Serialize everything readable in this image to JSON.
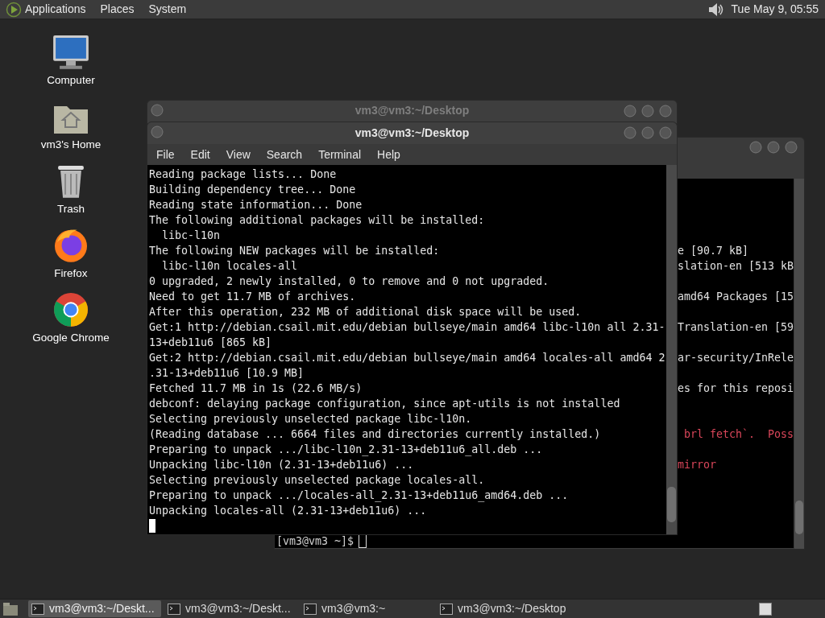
{
  "top_panel": {
    "menus": [
      "Applications",
      "Places",
      "System"
    ],
    "clock": "Tue May 9, 05:55"
  },
  "desktop_icons": [
    {
      "kind": "computer",
      "label": "Computer"
    },
    {
      "kind": "home",
      "label": "vm3's Home"
    },
    {
      "kind": "trash",
      "label": "Trash"
    },
    {
      "kind": "firefox",
      "label": "Firefox"
    },
    {
      "kind": "chrome",
      "label": "Google Chrome"
    }
  ],
  "back_window": {
    "lines": [
      {
        "kind": "blank"
      },
      {
        "kind": "blank"
      },
      {
        "kind": "blank"
      },
      {
        "kind": "blank"
      },
      {
        "kind": "normal",
        "text": "e [90.7 kB]"
      },
      {
        "kind": "normal",
        "text": "slation-en [513 kB"
      },
      {
        "kind": "blank"
      },
      {
        "kind": "normal",
        "text": "amd64 Packages [15"
      },
      {
        "kind": "blank"
      },
      {
        "kind": "normal",
        "text": "Translation-en [59"
      },
      {
        "kind": "blank"
      },
      {
        "kind": "normal",
        "text": "ar-security/InRele"
      },
      {
        "kind": "blank"
      },
      {
        "kind": "normal",
        "text": "es for this reposi"
      },
      {
        "kind": "blank"
      },
      {
        "kind": "blank"
      },
      {
        "kind": "error",
        "text": " brl fetch`.  Poss"
      },
      {
        "kind": "blank"
      },
      {
        "kind": "error",
        "text": "mirror"
      }
    ],
    "prompt": "[vm3@vm3 ~]$"
  },
  "middle_window": {
    "title": "vm3@vm3:~/Desktop"
  },
  "front_window": {
    "title": "vm3@vm3:~/Desktop",
    "menu": [
      "File",
      "Edit",
      "View",
      "Search",
      "Terminal",
      "Help"
    ],
    "lines": [
      "Reading package lists... Done",
      "Building dependency tree... Done",
      "Reading state information... Done",
      "The following additional packages will be installed:",
      "  libc-l10n",
      "The following NEW packages will be installed:",
      "  libc-l10n locales-all",
      "0 upgraded, 2 newly installed, 0 to remove and 0 not upgraded.",
      "Need to get 11.7 MB of archives.",
      "After this operation, 232 MB of additional disk space will be used.",
      "Get:1 http://debian.csail.mit.edu/debian bullseye/main amd64 libc-l10n all 2.31-",
      "13+deb11u6 [865 kB]",
      "Get:2 http://debian.csail.mit.edu/debian bullseye/main amd64 locales-all amd64 2",
      ".31-13+deb11u6 [10.9 MB]",
      "Fetched 11.7 MB in 1s (22.6 MB/s)",
      "debconf: delaying package configuration, since apt-utils is not installed",
      "Selecting previously unselected package libc-l10n.",
      "(Reading database ... 6664 files and directories currently installed.)",
      "Preparing to unpack .../libc-l10n_2.31-13+deb11u6_all.deb ...",
      "Unpacking libc-l10n (2.31-13+deb11u6) ...",
      "Selecting previously unselected package locales-all.",
      "Preparing to unpack .../locales-all_2.31-13+deb11u6_amd64.deb ...",
      "Unpacking locales-all (2.31-13+deb11u6) ..."
    ]
  },
  "taskbar": [
    {
      "label": "vm3@vm3:~/Deskt...",
      "selected": true
    },
    {
      "label": "vm3@vm3:~/Deskt...",
      "selected": false
    },
    {
      "label": "vm3@vm3:~",
      "selected": false
    },
    {
      "label": "vm3@vm3:~/Desktop",
      "selected": false
    }
  ]
}
